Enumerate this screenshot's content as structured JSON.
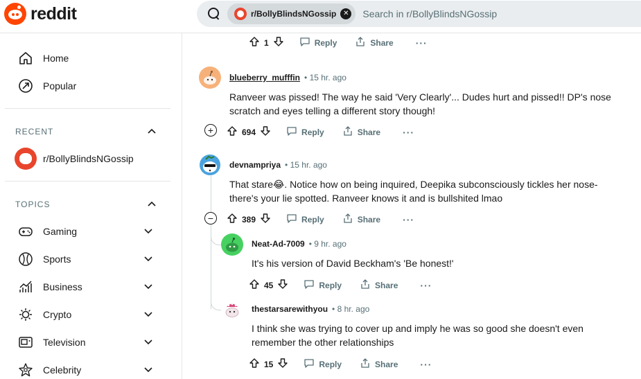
{
  "header": {
    "logo_text": "reddit",
    "search_chip": "r/BollyBlindsNGossip",
    "search_placeholder": "Search in r/BollyBlindsNGossip"
  },
  "sidebar": {
    "top_items": [
      {
        "label": "Home",
        "icon": "home-icon"
      },
      {
        "label": "Popular",
        "icon": "popular-icon"
      }
    ],
    "recent_title": "RECENT",
    "recent_items": [
      {
        "label": "r/BollyBlindsNGossip"
      }
    ],
    "topics_title": "TOPICS",
    "topics": [
      {
        "label": "Gaming",
        "icon": "gamepad-icon"
      },
      {
        "label": "Sports",
        "icon": "sports-ball-icon"
      },
      {
        "label": "Business",
        "icon": "chart-icon"
      },
      {
        "label": "Crypto",
        "icon": "crypto-icon"
      },
      {
        "label": "Television",
        "icon": "tv-icon"
      },
      {
        "label": "Celebrity",
        "icon": "star-icon"
      }
    ]
  },
  "labels": {
    "reply": "Reply",
    "share": "Share",
    "more": "···"
  },
  "top_action_row": {
    "votes": "1"
  },
  "comments": [
    {
      "author": "blueberry_mufffin",
      "time": "15 hr. ago",
      "body": "Ranveer was pissed! The way he said 'Very Clearly'... Dudes hurt and pissed!! DP's nose scratch and eyes telling a different story though!",
      "votes": "694",
      "toggle": "+"
    },
    {
      "author": "devnampriya",
      "time": "15 hr. ago",
      "body_before": "That stare",
      "body_emoji": "😂",
      "body_after": ". Notice how on being inquired, Deepika subconsciously tickles her nose- there's your lie spotted. Ranveer knows it and is bullshited lmao",
      "votes": "389",
      "toggle": "−"
    },
    {
      "author": "Neat-Ad-7009",
      "time": "9 hr. ago",
      "body": "It's his version of David Beckham's 'Be honest!'",
      "votes": "45"
    },
    {
      "author": "thestarsarewithyou",
      "time": "8 hr. ago",
      "body": "I think she was trying to cover up and imply he was so good she doesn't even remember the other relationships",
      "votes": "15"
    }
  ],
  "colors": {
    "brand": "#ff4500",
    "meta": "#576f76",
    "search_bg": "#eaedef"
  }
}
